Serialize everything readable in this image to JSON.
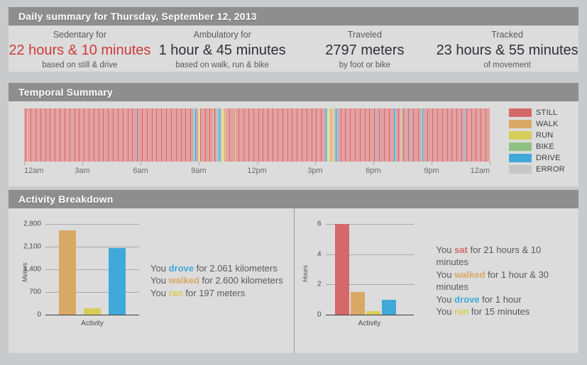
{
  "header": {
    "title": "Daily summary for Thursday, September 12, 2013"
  },
  "summary": {
    "cells": [
      {
        "label": "Sedentary for",
        "value": "22 hours & 10 minutes",
        "sub": "based on still & drive",
        "alert": true
      },
      {
        "label": "Ambulatory for",
        "value": "1 hour & 45 minutes",
        "sub": "based on walk, run & bike",
        "alert": false
      },
      {
        "label": "Traveled",
        "value": "2797 meters",
        "sub": "by foot or bike",
        "alert": false
      },
      {
        "label": "Tracked",
        "value": "23 hours & 55 minutes",
        "sub": "of movement",
        "alert": false
      }
    ]
  },
  "temporal": {
    "title": "Temporal Summary",
    "axis_ticks": [
      "12am",
      "3am",
      "6am",
      "9am",
      "12pm",
      "3pm",
      "6pm",
      "9pm",
      "12am"
    ],
    "legend": [
      {
        "label": "STILL",
        "color": "#d4686a"
      },
      {
        "label": "WALK",
        "color": "#d7a965"
      },
      {
        "label": "RUN",
        "color": "#d8cd59"
      },
      {
        "label": "BIKE",
        "color": "#90c184"
      },
      {
        "label": "DRIVE",
        "color": "#3fa9da"
      },
      {
        "label": "ERROR",
        "color": "#c6c6c6"
      }
    ],
    "timeline": [
      "still",
      "still",
      "still",
      "walk",
      "still",
      "still",
      "still",
      "still",
      "still",
      "still",
      "still",
      "still",
      "still",
      "still",
      "still",
      "still",
      "still",
      "still",
      "still",
      "still",
      "still",
      "still",
      "still",
      "still",
      "still",
      "still",
      "still",
      "still",
      "still",
      "still",
      "still",
      "still",
      "still",
      "still",
      "still",
      "still",
      "still",
      "still",
      "still",
      "still",
      "still",
      "still",
      "still",
      "still",
      "still",
      "still",
      "still",
      "still",
      "still",
      "still",
      "still",
      "still",
      "still",
      "still",
      "still",
      "still",
      "still",
      "still",
      "still",
      "still",
      "still",
      "still",
      "still",
      "still",
      "still",
      "still",
      "still",
      "still",
      "still",
      "still",
      "still",
      "still",
      "still",
      "still",
      "still",
      "still",
      "still",
      "still",
      "still",
      "still",
      "still",
      "still",
      "still",
      "still",
      "still",
      "still",
      "still",
      "still",
      "still",
      "still",
      "still",
      "still",
      "still",
      "still",
      "still",
      "still",
      "still",
      "still",
      "still",
      "still",
      "still",
      "still",
      "still",
      "still",
      "still",
      "still",
      "still",
      "still",
      "still",
      "still",
      "still",
      "still",
      "still",
      "still",
      "still",
      "still",
      "still",
      "still",
      "still",
      "still",
      "still",
      "still",
      "still",
      "still",
      "still",
      "still",
      "still",
      "still",
      "still",
      "still",
      "still",
      "still",
      "still",
      "still",
      "still",
      "drive",
      "still",
      "still",
      "still",
      "still",
      "still",
      "still",
      "still",
      "still",
      "still",
      "still",
      "still",
      "still",
      "still",
      "still",
      "still",
      "still",
      "still",
      "still",
      "still",
      "still",
      "still",
      "still",
      "still",
      "still",
      "still",
      "still",
      "still",
      "still",
      "still",
      "still",
      "still",
      "still",
      "still",
      "still",
      "still",
      "still",
      "still",
      "still",
      "still",
      "still",
      "still",
      "still",
      "still",
      "still",
      "still",
      "still",
      "still",
      "still",
      "still",
      "still",
      "still",
      "still",
      "still",
      "still",
      "still",
      "still",
      "still",
      "still",
      "still",
      "still",
      "still",
      "still",
      "still",
      "still",
      "still",
      "still",
      "still",
      "drive",
      "walk",
      "drive",
      "drive",
      "still",
      "still",
      "walk",
      "run",
      "run",
      "still",
      "still",
      "still",
      "still",
      "still",
      "still",
      "still",
      "still",
      "still",
      "still",
      "still",
      "still",
      "still",
      "still",
      "still",
      "walk",
      "still",
      "still",
      "still",
      "walk",
      "drive",
      "drive",
      "drive",
      "drive",
      "walk",
      "walk",
      "run",
      "run",
      "walk",
      "walk",
      "still",
      "still",
      "still",
      "still",
      "still",
      "still",
      "still",
      "still",
      "still",
      "still",
      "still",
      "walk",
      "still",
      "still",
      "still",
      "still",
      "still",
      "still",
      "still",
      "still",
      "still",
      "still",
      "still",
      "still",
      "still",
      "still",
      "still",
      "still",
      "still",
      "still",
      "still",
      "still",
      "still",
      "still",
      "still",
      "still",
      "still",
      "still",
      "still",
      "still",
      "still",
      "still",
      "still",
      "still",
      "still",
      "still",
      "still",
      "still",
      "still",
      "still",
      "still",
      "still",
      "still",
      "still",
      "still",
      "still",
      "still",
      "still",
      "still",
      "still",
      "still",
      "still",
      "still",
      "still",
      "still",
      "still",
      "still",
      "still",
      "still",
      "still",
      "still",
      "still",
      "still",
      "still",
      "still",
      "still",
      "still",
      "still",
      "still",
      "still",
      "still",
      "still",
      "still",
      "still",
      "still",
      "still",
      "still",
      "still",
      "still",
      "still",
      "still",
      "still",
      "still",
      "still",
      "still",
      "still",
      "still",
      "still",
      "still",
      "still",
      "still",
      "still",
      "still",
      "still",
      "still",
      "still",
      "still",
      "still",
      "still",
      "still",
      "still",
      "still",
      "still",
      "still",
      "still",
      "still",
      "still",
      "still",
      "still",
      "still",
      "drive",
      "drive",
      "run",
      "run",
      "run",
      "walk",
      "walk",
      "walk",
      "walk",
      "walk",
      "walk",
      "walk",
      "drive",
      "drive",
      "still",
      "drive",
      "still",
      "still",
      "still",
      "still",
      "still",
      "still",
      "still",
      "still",
      "still",
      "still",
      "still",
      "still",
      "still",
      "still",
      "still",
      "still",
      "still",
      "still",
      "still",
      "still",
      "still",
      "still",
      "still",
      "still",
      "still",
      "still",
      "still",
      "still",
      "still",
      "still",
      "still",
      "still",
      "still",
      "still",
      "still",
      "still",
      "still",
      "still",
      "still",
      "still",
      "still",
      "still",
      "still",
      "still",
      "still",
      "still",
      "still",
      "drive",
      "still",
      "still",
      "still",
      "still",
      "still",
      "still",
      "still",
      "still",
      "still",
      "still",
      "still",
      "still",
      "still",
      "still",
      "still",
      "still",
      "still",
      "still",
      "still",
      "drive",
      "drive",
      "still",
      "still",
      "still",
      "still",
      "still",
      "walk",
      "walk",
      "still",
      "drive",
      "still",
      "still",
      "still",
      "still",
      "still",
      "still",
      "still",
      "drive",
      "still",
      "still",
      "still",
      "still",
      "still",
      "still",
      "still",
      "still",
      "still",
      "still",
      "still",
      "still",
      "still",
      "drive",
      "walk",
      "drive",
      "still",
      "still",
      "still",
      "still",
      "still",
      "still",
      "still",
      "still",
      "still",
      "still",
      "still",
      "still",
      "still",
      "still",
      "still",
      "still",
      "still",
      "still",
      "still",
      "still",
      "still",
      "still",
      "still",
      "still",
      "still",
      "still",
      "still",
      "still",
      "still",
      "still",
      "still",
      "still",
      "still",
      "still",
      "still",
      "still",
      "still",
      "still",
      "still",
      "still",
      "still",
      "still",
      "still",
      "still",
      "still",
      "still",
      "still",
      "still",
      "drive",
      "drive",
      "still",
      "still",
      "still",
      "still",
      "still",
      "still",
      "still",
      "still",
      "still",
      "still",
      "still",
      "still",
      "still",
      "still",
      "still",
      "still",
      "still",
      "still",
      "still",
      "still",
      "still",
      "still",
      "still",
      "still",
      "still",
      "still",
      "still",
      "still",
      "still",
      "still"
    ]
  },
  "activity": {
    "title": "Activity Breakdown",
    "left_blurb": [
      {
        "pre": "You ",
        "verb": "drove",
        "verb_color": "#3fa9da",
        "post": " for 2.061 kilometers"
      },
      {
        "pre": "You ",
        "verb": "walked",
        "verb_color": "#d7a965",
        "post": " for 2.600 kilometers"
      },
      {
        "pre": "You ",
        "verb": "ran",
        "verb_color": "#d8cd59",
        "post": " for 197 meters"
      }
    ],
    "right_blurb": [
      {
        "pre": "You ",
        "verb": "sat",
        "verb_color": "#d4686a",
        "post": " for 21 hours & 10 minutes"
      },
      {
        "pre": "You ",
        "verb": "walked",
        "verb_color": "#d7a965",
        "post": " for 1 hour & 30 minutes"
      },
      {
        "pre": "You ",
        "verb": "drove",
        "verb_color": "#3fa9da",
        "post": " for 1 hour"
      },
      {
        "pre": "You ",
        "verb": "ran",
        "verb_color": "#d8cd59",
        "post": " for 15 minutes"
      }
    ]
  },
  "chart_data": [
    {
      "type": "bar",
      "title": "",
      "xlabel": "Activity",
      "ylabel": "Meters",
      "categories": [
        "walk",
        "run",
        "drive"
      ],
      "values": [
        2600,
        197,
        2061
      ],
      "colors": [
        "#d7a965",
        "#d8cd59",
        "#3fa9da"
      ],
      "yticks": [
        0,
        700,
        1400,
        2100,
        2800
      ],
      "ytick_labels": [
        "0",
        "700",
        "1,400",
        "2,100",
        "2,800"
      ],
      "ylim": [
        0,
        2800
      ],
      "grid": true,
      "legend": "none"
    },
    {
      "type": "bar",
      "title": "",
      "xlabel": "Activity",
      "ylabel": "Hours",
      "categories": [
        "still",
        "walk",
        "run",
        "drive"
      ],
      "values": [
        6,
        1.5,
        0.25,
        1
      ],
      "colors": [
        "#d4686a",
        "#d7a965",
        "#d8cd59",
        "#3fa9da"
      ],
      "yticks": [
        0,
        2,
        4,
        6
      ],
      "ytick_labels": [
        "0",
        "2",
        "4",
        "6"
      ],
      "ylim": [
        0,
        6
      ],
      "grid": true,
      "legend": "none"
    }
  ]
}
